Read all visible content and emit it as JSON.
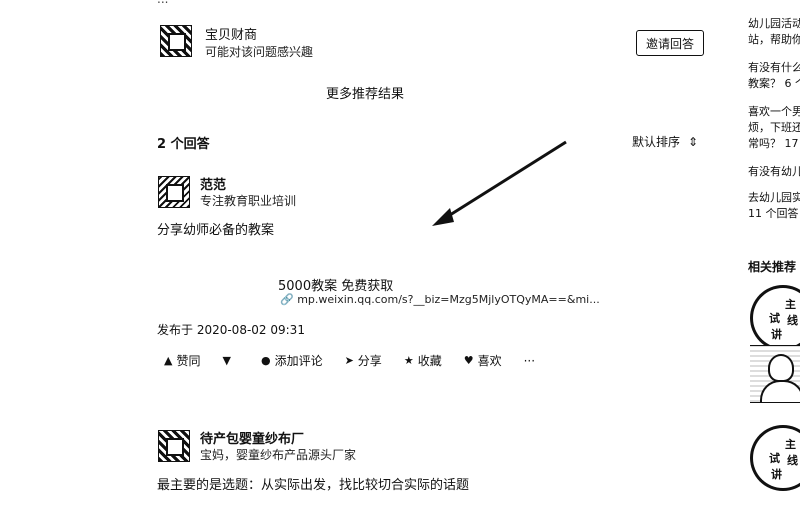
{
  "recommended": {
    "top_cut_text": "...",
    "user": {
      "name": "宝贝财商",
      "subtitle": "可能对该问题感兴趣"
    },
    "invite_label": "邀请回答",
    "more_label": "更多推荐结果"
  },
  "answers_header": {
    "count_label": "2 个回答",
    "sort_label": "默认排序",
    "sort_icon": "⇕"
  },
  "answer1": {
    "author": "范范",
    "author_bio": "专注教育职业培训",
    "text": "分享幼师必备的教案",
    "card_title": "5000教案 免费获取",
    "card_link": "mp.weixin.qq.com/s?__biz=Mzg5MjlyOTQyMA==&mi...",
    "date": "发布于 2020-08-02 09:31",
    "actions": {
      "upvote": "赞同",
      "downvote_icon": "▼",
      "comment": "添加评论",
      "share": "分享",
      "favorite": "收藏",
      "like": "喜欢",
      "more": "···"
    }
  },
  "answer2": {
    "author": "待产包婴童纱布厂",
    "author_bio": "宝妈，婴童纱布产品源头厂家",
    "text": "最主要的是选题：从实际出发，找比较切合实际的话题"
  },
  "sidebar": {
    "items": [
      {
        "line1": "幼儿园活动",
        "line2": "站，帮助你"
      },
      {
        "line1": "有没有什么",
        "line2": "教案？ 6 个"
      },
      {
        "line1": "喜欢一个男",
        "line2": "烦，下班还",
        "line3": "常吗？ 17"
      },
      {
        "line1": "有没有幼儿"
      },
      {
        "line1": "去幼儿园实",
        "line2": "11 个回答"
      }
    ],
    "related_label": "相关推荐",
    "circle_text_1": "主",
    "circle_text_2": "试",
    "circle_text_3": "讲",
    "circle_text_4": "线"
  }
}
